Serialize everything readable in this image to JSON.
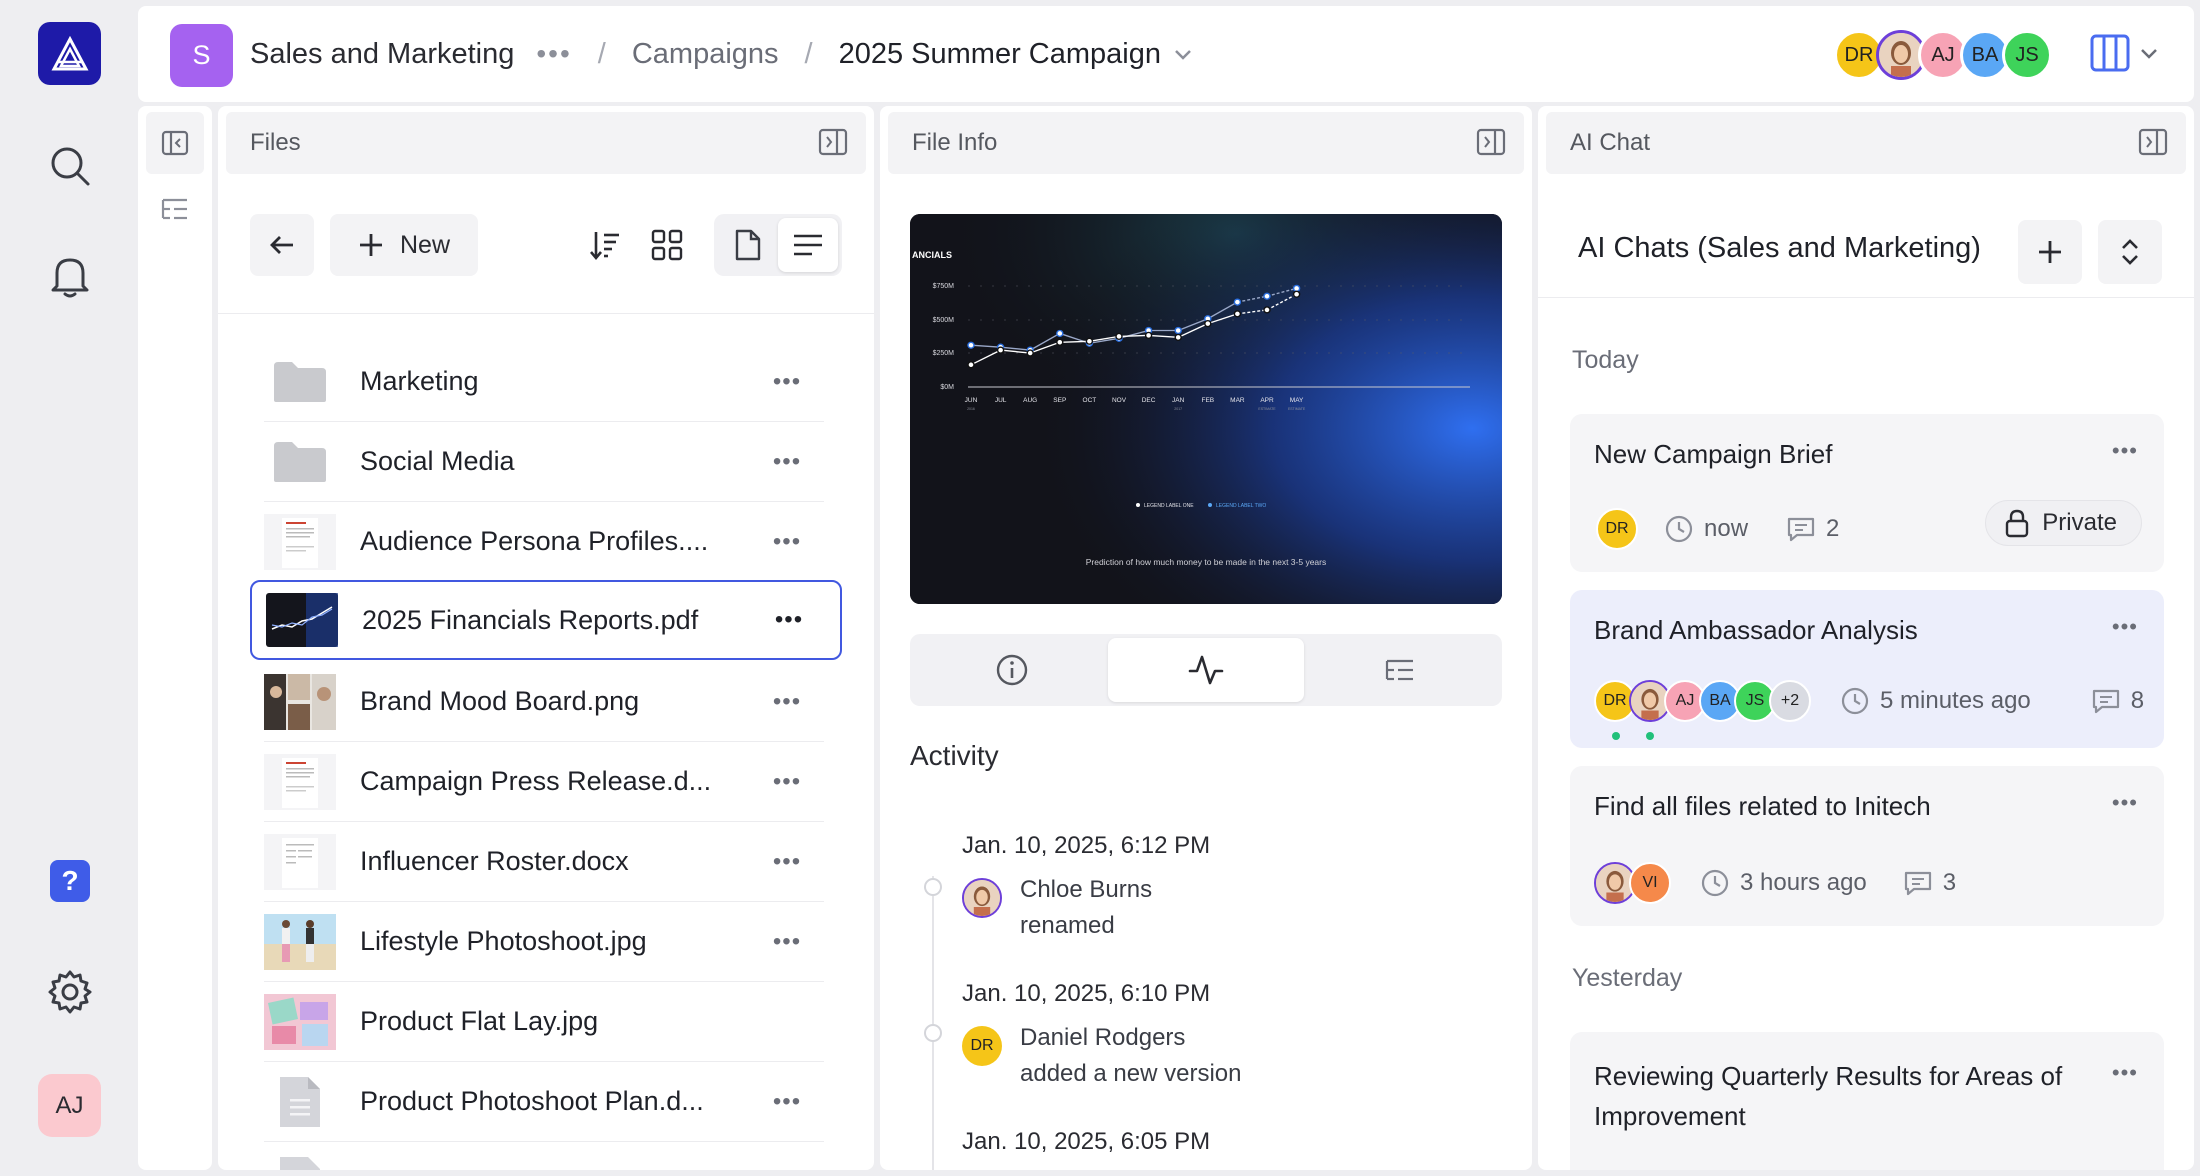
{
  "rail": {
    "help_label": "?",
    "user_initials": "AJ"
  },
  "header": {
    "workspace_initial": "S",
    "breadcrumbs": [
      "Sales and Marketing",
      "Campaigns",
      "2025 Summer Campaign"
    ],
    "more": "•••",
    "sep": "/",
    "avatars": [
      {
        "initials": "DR",
        "color": "#f5c518"
      },
      {
        "initials": "",
        "color": "#d9a07a",
        "photo": true
      },
      {
        "initials": "AJ",
        "color": "#f7a3b5"
      },
      {
        "initials": "BA",
        "color": "#5aa7f5"
      },
      {
        "initials": "JS",
        "color": "#3ed35a"
      }
    ]
  },
  "files": {
    "title": "Files",
    "new_label": "New",
    "items": [
      {
        "name": "Marketing",
        "type": "folder"
      },
      {
        "name": "Social Media",
        "type": "folder"
      },
      {
        "name": "Audience Persona Profiles....",
        "type": "doc"
      },
      {
        "name": "2025 Financials Reports.pdf",
        "type": "chart",
        "selected": true
      },
      {
        "name": "Brand Mood Board.png",
        "type": "photo"
      },
      {
        "name": "Campaign Press Release.d...",
        "type": "doc"
      },
      {
        "name": "Influencer Roster.docx",
        "type": "doc"
      },
      {
        "name": "Lifestyle Photoshoot.jpg",
        "type": "beach"
      },
      {
        "name": "Product Flat Lay.jpg",
        "type": "flat"
      },
      {
        "name": "Product Photoshoot Plan.d...",
        "type": "file"
      }
    ]
  },
  "fileinfo": {
    "title": "File Info",
    "preview": {
      "heading": "ANCIALS",
      "y_ticks": [
        "$750M",
        "$500M",
        "$250M",
        "$0M"
      ],
      "months": [
        "JUN",
        "JUL",
        "AUG",
        "SEP",
        "OCT",
        "NOV",
        "DEC",
        "JAN",
        "FEB",
        "MAR",
        "APR",
        "MAY"
      ],
      "sub_ticks": {
        "JUN": "2016",
        "JAN": "2017",
        "APR": "ESTIMATE",
        "MAY": "ESTIMATE"
      },
      "legend": [
        "LEGEND LABEL ONE",
        "LEGEND LABEL TWO"
      ],
      "caption": "Prediction of how much money to be made in the next 3-5 years"
    },
    "activity_title": "Activity",
    "events": [
      {
        "time": "Jan. 10, 2025, 6:12 PM",
        "user": "Chloe Burns",
        "action": "renamed",
        "avatar": "photo"
      },
      {
        "time": "Jan. 10, 2025, 6:10 PM",
        "user": "Daniel Rodgers",
        "action": "added a new version",
        "avatar": "DR"
      },
      {
        "time": "Jan. 10, 2025, 6:05 PM",
        "user": "",
        "action": "",
        "avatar": ""
      }
    ]
  },
  "chat": {
    "title": "AI Chat",
    "list_title": "AI Chats (Sales and Marketing)",
    "today": "Today",
    "yesterday": "Yesterday",
    "more": "•••",
    "cards": [
      {
        "title": "New Campaign Brief",
        "time": "now",
        "comments": "2",
        "private_label": "Private"
      },
      {
        "title": "Brand Ambassador Analysis",
        "time": "5 minutes ago",
        "comments": "8",
        "extra": "+2"
      },
      {
        "title": "Find all files related to Initech",
        "time": "3 hours ago",
        "comments": "3",
        "vi": "VI"
      },
      {
        "title": "Reviewing Quarterly Results for Areas of Improvement"
      }
    ]
  },
  "colors": {
    "accent": "#4158e0",
    "brand": "#1e1aa8",
    "workspace": "#a562f0",
    "dr": "#f5c518",
    "aj": "#f7a3b5",
    "ba": "#5aa7f5",
    "js": "#3ed35a",
    "vi": "#f5894a"
  }
}
